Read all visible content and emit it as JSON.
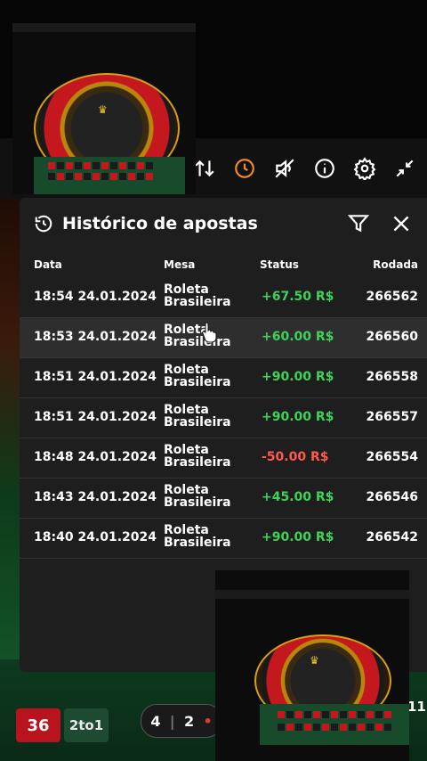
{
  "toolbar": {
    "icons": [
      "sort-icon",
      "history-icon",
      "mute-icon",
      "info-icon",
      "settings-icon",
      "collapse-icon"
    ],
    "active_icon_color": "#f58a2a"
  },
  "panel": {
    "title": "Histórico de apostas",
    "columns": {
      "date": "Data",
      "table": "Mesa",
      "status": "Status",
      "round": "Rodada"
    },
    "rows": [
      {
        "date": "18:54 24.01.2024",
        "table_line1": "Roleta",
        "table_line2": "Brasileira",
        "status": "+67.50 R$",
        "result": "win",
        "round": "266562"
      },
      {
        "date": "18:53 24.01.2024",
        "table_line1": "Roleta",
        "table_line2": "Brasileira",
        "status": "+60.00 R$",
        "result": "win",
        "round": "266560"
      },
      {
        "date": "18:51 24.01.2024",
        "table_line1": "Roleta",
        "table_line2": "Brasileira",
        "status": "+90.00 R$",
        "result": "win",
        "round": "266558"
      },
      {
        "date": "18:51 24.01.2024",
        "table_line1": "Roleta",
        "table_line2": "Brasileira",
        "status": "+90.00 R$",
        "result": "win",
        "round": "266557"
      },
      {
        "date": "18:48 24.01.2024",
        "table_line1": "Roleta",
        "table_line2": "Brasileira",
        "status": "-50.00 R$",
        "result": "loss",
        "round": "266554"
      },
      {
        "date": "18:43 24.01.2024",
        "table_line1": "Roleta",
        "table_line2": "Brasileira",
        "status": "+45.00 R$",
        "result": "win",
        "round": "266546"
      },
      {
        "date": "18:40 24.01.2024",
        "table_line1": "Roleta",
        "table_line2": "Brasileira",
        "status": "+90.00 R$",
        "result": "win",
        "round": "266542"
      }
    ],
    "colors": {
      "win": "#3dd35a",
      "loss": "#ff5a4a"
    }
  },
  "background": {
    "number_cell": "36",
    "column_bet": "2to1",
    "chip_values": [
      "4",
      "2"
    ],
    "edge_number": "11"
  }
}
